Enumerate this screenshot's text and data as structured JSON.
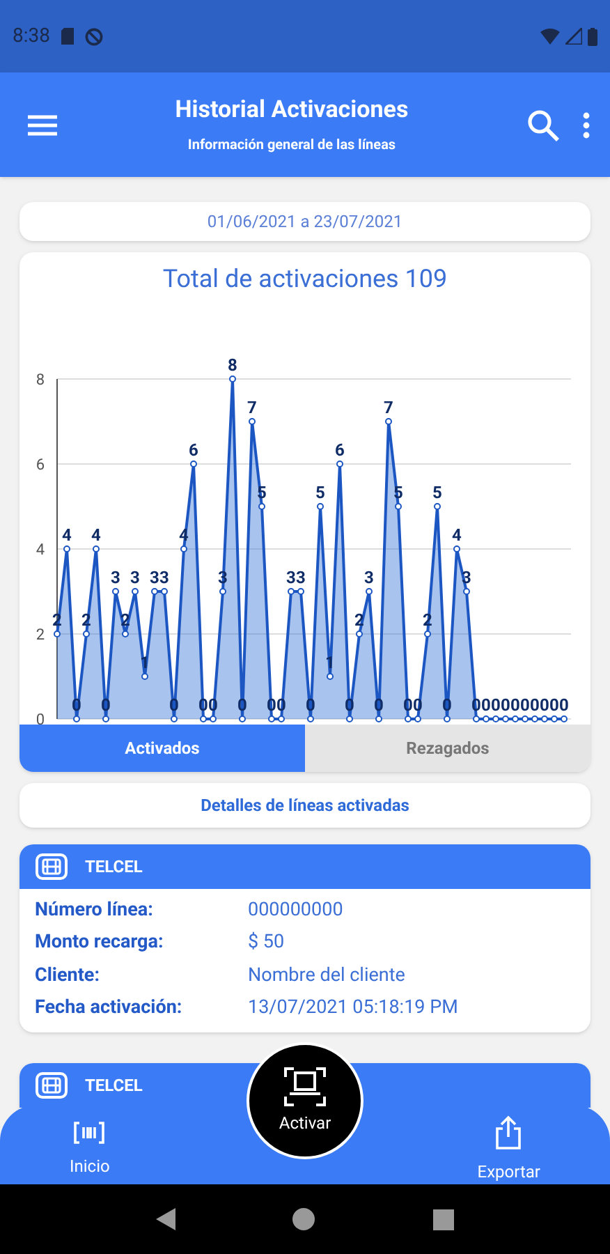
{
  "status_bar": {
    "time": "8:38"
  },
  "app_bar": {
    "title": "Historial Activaciones",
    "subtitle": "Información general de las líneas"
  },
  "date_range": "01/06/2021 a 23/07/2021",
  "chart": {
    "title": "Total de activaciones 109",
    "chart_data": {
      "type": "area",
      "grid": true,
      "ylim": [
        0,
        8
      ],
      "yticks": [
        0,
        2,
        4,
        6,
        8
      ],
      "data_labels": true,
      "series": [
        {
          "color": "#3f7bd6",
          "values": [
            2,
            4,
            0,
            2,
            4,
            0,
            3,
            2,
            3,
            1,
            3,
            3,
            0,
            4,
            6,
            0,
            0,
            3,
            8,
            0,
            7,
            5,
            0,
            0,
            3,
            3,
            0,
            5,
            1,
            6,
            0,
            2,
            3,
            0,
            7,
            5,
            0,
            0,
            2,
            5,
            0,
            4,
            3,
            0,
            0,
            0,
            0,
            0,
            0,
            0,
            0,
            0,
            0
          ]
        }
      ]
    }
  },
  "tabs": [
    {
      "label": "Activados",
      "selected": true
    },
    {
      "label": "Rezagados",
      "selected": false
    }
  ],
  "details_button": "Detalles de líneas activadas",
  "lines": [
    {
      "carrier": "TELCEL",
      "fields": [
        {
          "label": "Número línea:",
          "value": "000000000"
        },
        {
          "label": "Monto recarga:",
          "value": "$ 50"
        },
        {
          "label": "Cliente:",
          "value": "Nombre del cliente"
        },
        {
          "label": "Fecha activación:",
          "value": "13/07/2021 05:18:19 PM"
        }
      ]
    },
    {
      "carrier": "TELCEL"
    }
  ],
  "bottom_nav": [
    {
      "kind": "home",
      "label": "Inicio"
    },
    {
      "kind": "activate",
      "label": "Activar"
    },
    {
      "kind": "export",
      "label": "Exportar"
    }
  ]
}
